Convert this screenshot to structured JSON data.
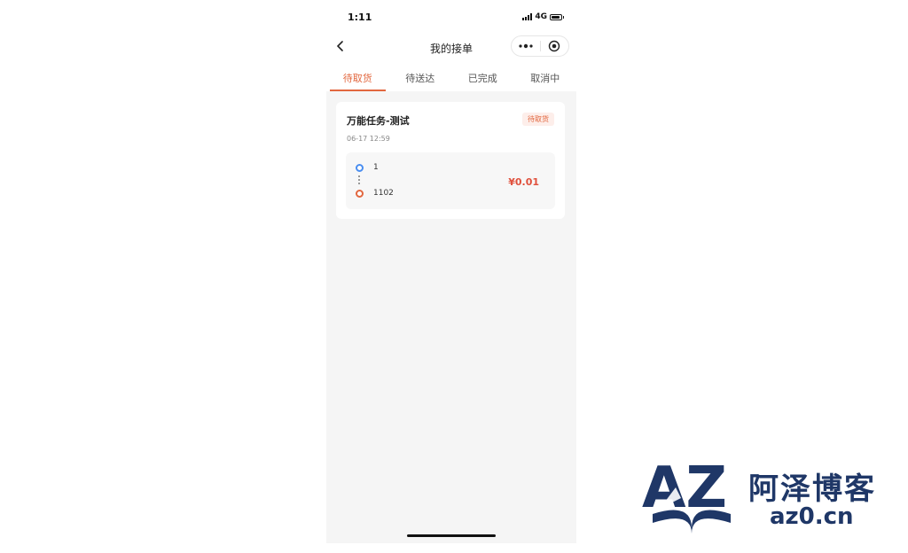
{
  "status_bar": {
    "time": "1:11",
    "network": "4G"
  },
  "nav": {
    "title": "我的接单"
  },
  "tabs": [
    {
      "label": "待取货",
      "active": true
    },
    {
      "label": "待送达",
      "active": false
    },
    {
      "label": "已完成",
      "active": false
    },
    {
      "label": "取消中",
      "active": false
    }
  ],
  "order": {
    "title": "万能任务-测试",
    "status": "待取货",
    "time": "06-17 12:59",
    "from": "1",
    "to": "1102",
    "price": "¥0.01"
  },
  "watermark": {
    "logo_text": "AZ",
    "name": "阿泽博客",
    "domain": "az0.cn"
  },
  "colors": {
    "accent": "#e2673f",
    "price": "#e0503c",
    "from_dot": "#4a8ef0",
    "brand": "#1f3767"
  }
}
